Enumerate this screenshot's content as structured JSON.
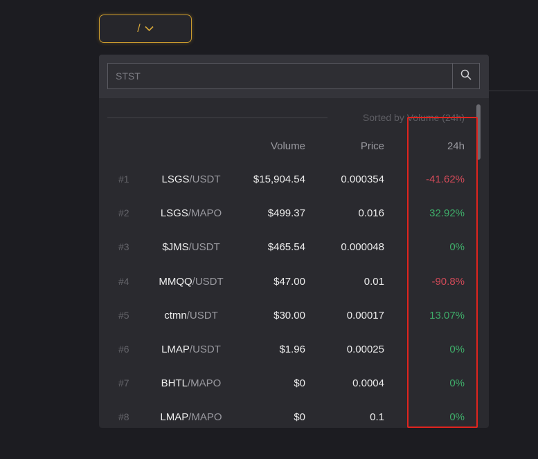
{
  "pair_selector": {
    "label": "/"
  },
  "search": {
    "value": "",
    "placeholder": "STST"
  },
  "sort_label": "Sorted by Volume (24h)",
  "columns": {
    "volume": "Volume",
    "price": "Price",
    "change": "24h"
  },
  "rows": [
    {
      "rank": "#1",
      "base": "LSGS",
      "quote": "/USDT",
      "volume": "$15,904.54",
      "price": "0.000354",
      "change": "-41.62%"
    },
    {
      "rank": "#2",
      "base": "LSGS",
      "quote": "/MAPO",
      "volume": "$499.37",
      "price": "0.016",
      "change": "32.92%"
    },
    {
      "rank": "#3",
      "base": "$JMS",
      "quote": "/USDT",
      "volume": "$465.54",
      "price": "0.000048",
      "change": "0%"
    },
    {
      "rank": "#4",
      "base": "MMQQ",
      "quote": "/USDT",
      "volume": "$47.00",
      "price": "0.01",
      "change": "-90.8%"
    },
    {
      "rank": "#5",
      "base": "ctmn",
      "quote": "/USDT",
      "volume": "$30.00",
      "price": "0.00017",
      "change": "13.07%"
    },
    {
      "rank": "#6",
      "base": "LMAP",
      "quote": "/USDT",
      "volume": "$1.96",
      "price": "0.00025",
      "change": "0%"
    },
    {
      "rank": "#7",
      "base": "BHTL",
      "quote": "/MAPO",
      "volume": "$0",
      "price": "0.0004",
      "change": "0%"
    },
    {
      "rank": "#8",
      "base": "LMAP",
      "quote": "/MAPO",
      "volume": "$0",
      "price": "0.1",
      "change": "0%"
    }
  ],
  "colors": {
    "accent": "#d9a93a",
    "negative": "#d14a58",
    "positive": "#3fae6a",
    "highlight": "#e0241e"
  },
  "icons": {
    "dropdown": "chevron-down-icon",
    "search": "search-icon"
  }
}
